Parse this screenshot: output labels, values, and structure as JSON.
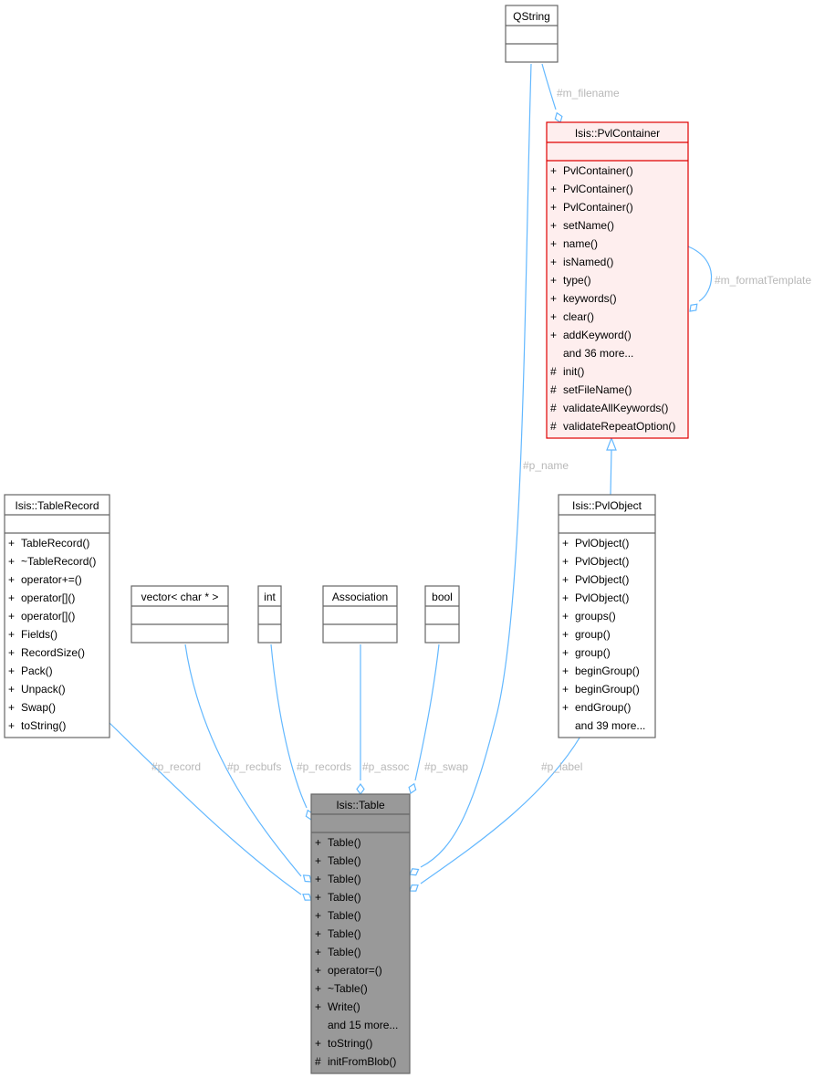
{
  "diagram": {
    "type": "UML collaboration diagram",
    "colors": {
      "edge": "#63b8ff",
      "edge_label": "#b8b8b8",
      "node_border": "#666666",
      "node_fill": "#ffffff",
      "focus_fill": "#999999",
      "focus_border": "#666666",
      "highlight_fill": "#feeeee",
      "highlight_border": "#e00000"
    },
    "nodes": {
      "qstring": {
        "title": "QString",
        "members": []
      },
      "pvlcontainer": {
        "title": "Isis::PvlContainer",
        "members": [
          {
            "vis": "+",
            "name": "PvlContainer()"
          },
          {
            "vis": "+",
            "name": "PvlContainer()"
          },
          {
            "vis": "+",
            "name": "PvlContainer()"
          },
          {
            "vis": "+",
            "name": "setName()"
          },
          {
            "vis": "+",
            "name": "name()"
          },
          {
            "vis": "+",
            "name": "isNamed()"
          },
          {
            "vis": "+",
            "name": "type()"
          },
          {
            "vis": "+",
            "name": "keywords()"
          },
          {
            "vis": "+",
            "name": "clear()"
          },
          {
            "vis": "+",
            "name": "addKeyword()"
          },
          {
            "vis": "",
            "name": "and 36 more..."
          },
          {
            "vis": "#",
            "name": "init()"
          },
          {
            "vis": "#",
            "name": "setFileName()"
          },
          {
            "vis": "#",
            "name": "validateAllKeywords()"
          },
          {
            "vis": "#",
            "name": "validateRepeatOption()"
          }
        ]
      },
      "pvlobject": {
        "title": "Isis::PvlObject",
        "members": [
          {
            "vis": "+",
            "name": "PvlObject()"
          },
          {
            "vis": "+",
            "name": "PvlObject()"
          },
          {
            "vis": "+",
            "name": "PvlObject()"
          },
          {
            "vis": "+",
            "name": "PvlObject()"
          },
          {
            "vis": "+",
            "name": "groups()"
          },
          {
            "vis": "+",
            "name": "group()"
          },
          {
            "vis": "+",
            "name": "group()"
          },
          {
            "vis": "+",
            "name": "beginGroup()"
          },
          {
            "vis": "+",
            "name": "beginGroup()"
          },
          {
            "vis": "+",
            "name": "endGroup()"
          },
          {
            "vis": "",
            "name": "and 39 more..."
          }
        ]
      },
      "tablerecord": {
        "title": "Isis::TableRecord",
        "members": [
          {
            "vis": "+",
            "name": "TableRecord()"
          },
          {
            "vis": "+",
            "name": "~TableRecord()"
          },
          {
            "vis": "+",
            "name": "operator+=()"
          },
          {
            "vis": "+",
            "name": "operator[]()"
          },
          {
            "vis": "+",
            "name": "operator[]()"
          },
          {
            "vis": "+",
            "name": "Fields()"
          },
          {
            "vis": "+",
            "name": "RecordSize()"
          },
          {
            "vis": "+",
            "name": "Pack()"
          },
          {
            "vis": "+",
            "name": "Unpack()"
          },
          {
            "vis": "+",
            "name": "Swap()"
          },
          {
            "vis": "+",
            "name": "toString()"
          }
        ]
      },
      "vector": {
        "title": "vector< char * >",
        "members": []
      },
      "int": {
        "title": "int",
        "members": []
      },
      "association": {
        "title": "Association",
        "members": []
      },
      "bool": {
        "title": "bool",
        "members": []
      },
      "table": {
        "title": "Isis::Table",
        "members": [
          {
            "vis": "+",
            "name": "Table()"
          },
          {
            "vis": "+",
            "name": "Table()"
          },
          {
            "vis": "+",
            "name": "Table()"
          },
          {
            "vis": "+",
            "name": "Table()"
          },
          {
            "vis": "+",
            "name": "Table()"
          },
          {
            "vis": "+",
            "name": "Table()"
          },
          {
            "vis": "+",
            "name": "Table()"
          },
          {
            "vis": "+",
            "name": "operator=()"
          },
          {
            "vis": "+",
            "name": "~Table()"
          },
          {
            "vis": "+",
            "name": "Write()"
          },
          {
            "vis": "",
            "name": "and 15 more..."
          },
          {
            "vis": "+",
            "name": "toString()"
          },
          {
            "vis": "#",
            "name": "initFromBlob()"
          }
        ]
      }
    },
    "edges": [
      {
        "from": "qstring",
        "to": "pvlcontainer",
        "kind": "composition",
        "label": "#m_filename"
      },
      {
        "from": "pvlcontainer",
        "to": "pvlcontainer",
        "kind": "composition",
        "label": "#m_formatTemplate"
      },
      {
        "from": "pvlobject",
        "to": "pvlcontainer",
        "kind": "inheritance",
        "label": ""
      },
      {
        "from": "qstring",
        "to": "table",
        "kind": "composition",
        "label": "#p_name"
      },
      {
        "from": "tablerecord",
        "to": "table",
        "kind": "composition",
        "label": "#p_record"
      },
      {
        "from": "vector",
        "to": "table",
        "kind": "composition",
        "label": "#p_recbufs"
      },
      {
        "from": "int",
        "to": "table",
        "kind": "composition",
        "label": "#p_records"
      },
      {
        "from": "association",
        "to": "table",
        "kind": "composition",
        "label": "#p_assoc"
      },
      {
        "from": "bool",
        "to": "table",
        "kind": "composition",
        "label": "#p_swap"
      },
      {
        "from": "pvlobject",
        "to": "table",
        "kind": "composition",
        "label": "#p_label"
      }
    ]
  }
}
